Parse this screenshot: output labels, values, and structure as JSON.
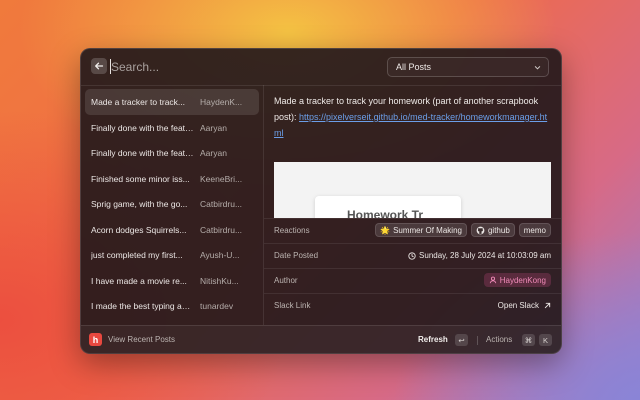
{
  "search": {
    "placeholder": "Search..."
  },
  "filter": {
    "selected": "All Posts"
  },
  "posts": [
    {
      "title": "Made a tracker to track...",
      "author": "HaydenK..."
    },
    {
      "title": "Finally done with the featur...",
      "author": "Aaryan"
    },
    {
      "title": "Finally done with the featur...",
      "author": "Aaryan"
    },
    {
      "title": "Finished some minor iss...",
      "author": "KeeneBri..."
    },
    {
      "title": "Sprig game, with the go...",
      "author": "Catbirdru..."
    },
    {
      "title": "Acorn dodges Squirrels...",
      "author": "Catbirdru..."
    },
    {
      "title": "just completed my first...",
      "author": "Ayush-U..."
    },
    {
      "title": "I have made a movie re...",
      "author": "NitishKu..."
    },
    {
      "title": "I made the best typing ani...",
      "author": "tunardev"
    }
  ],
  "detail": {
    "description": "Made a tracker to track your homework (part of another scrapbook post):",
    "link": "https://pixelverseit.github.io/med-tracker/homeworkmanager.html",
    "preview_text": "Homework Tr",
    "reactions_label": "Reactions",
    "reactions": [
      {
        "emoji": "🌟",
        "name": "Summer Of Making"
      },
      {
        "name": "github"
      },
      {
        "name": "memo"
      }
    ],
    "date_label": "Date Posted",
    "date": "Sunday, 28 July 2024 at 10:03:09 am",
    "author_label": "Author",
    "author": "HaydenKong",
    "slack_label": "Slack Link",
    "slack_action": "Open Slack"
  },
  "footer": {
    "logo": "h",
    "view_recent": "View Recent Posts",
    "refresh": "Refresh",
    "refresh_key": "↩",
    "actions": "Actions",
    "actions_key1": "⌘",
    "actions_key2": "K"
  },
  "icons": {
    "back": "arrow-left-icon",
    "dropdown": "chevron-down-icon",
    "github": "github-icon",
    "clock": "clock-icon",
    "person": "person-icon",
    "external": "arrow-up-right-icon"
  },
  "colors": {
    "accent_link": "#6b9ee8",
    "author_pink": "#f08ab8",
    "logo_red": "#e8483f"
  }
}
